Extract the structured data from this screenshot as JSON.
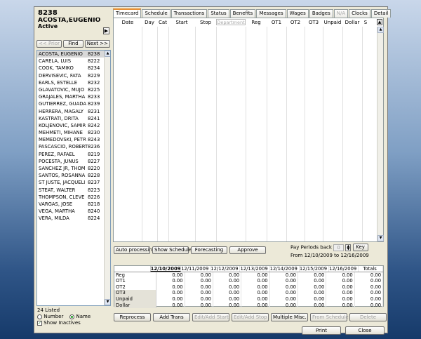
{
  "employee": {
    "id": "8238",
    "name": "ACOSTA,EUGENIO",
    "status": "Active"
  },
  "nav": {
    "prior": "<< Prior",
    "find": "Find",
    "next": "Next >>"
  },
  "employees": [
    {
      "name": "ACOSTA, EUGENIO",
      "id": "8238"
    },
    {
      "name": "CARELA, LUIS",
      "id": "8222"
    },
    {
      "name": "COOK, TAMIKO",
      "id": "8234"
    },
    {
      "name": "DERVISEVIC, FATA",
      "id": "8229"
    },
    {
      "name": "EARLS, ESTELLE",
      "id": "8232"
    },
    {
      "name": "GLAVATOVIC, MUJO",
      "id": "8225"
    },
    {
      "name": "GRAJALES, MARTHA",
      "id": "8233"
    },
    {
      "name": "GUTIERREZ, GUADA",
      "id": "8239"
    },
    {
      "name": "HERRERA, MAGALY",
      "id": "8231"
    },
    {
      "name": "KASTRATI, DRITA",
      "id": "8241"
    },
    {
      "name": "KOLJENOVIC, SAMIR",
      "id": "8242"
    },
    {
      "name": "MEHMETI, MIHANE",
      "id": "8230"
    },
    {
      "name": "MEMEDOVSKI, PETR",
      "id": "8243"
    },
    {
      "name": "PASCASCIO, ROBERT",
      "id": "8236"
    },
    {
      "name": "PEREZ, RAFAEL",
      "id": "8219"
    },
    {
      "name": "POCESTA, JUNUS",
      "id": "8227"
    },
    {
      "name": "SANCHEZ JR, THOM",
      "id": "8220"
    },
    {
      "name": "SANTOS, ROSANNA",
      "id": "8228"
    },
    {
      "name": "ST JUSTE, JACQUELI",
      "id": "8237"
    },
    {
      "name": "STEAT, WALTER",
      "id": "8223"
    },
    {
      "name": "THOMPSON, CLEVE",
      "id": "8226"
    },
    {
      "name": "VARGAS, JOSE",
      "id": "8218"
    },
    {
      "name": "VEGA, MARTHA",
      "id": "8240"
    },
    {
      "name": "VERA, MILDA",
      "id": "8224"
    }
  ],
  "list_footer": {
    "count": "24 Listed",
    "number": "Number",
    "name": "Name",
    "inactives": "Show Inactives"
  },
  "tabs": [
    "Timecard",
    "Schedule",
    "Transactions",
    "Status",
    "Benefits",
    "Messages",
    "Wages",
    "Badges",
    "N/A",
    "Clocks",
    "Detail"
  ],
  "timecard_columns": [
    "Date",
    "Day",
    "Cat",
    "Start",
    "Stop",
    "Department",
    "Reg",
    "OT1",
    "OT2",
    "OT3",
    "Unpaid",
    "Dollar",
    "S"
  ],
  "actions": {
    "auto": "Auto processing",
    "schedule": "Show Schedule",
    "forecast": "Forecasting",
    "approve": "Approve"
  },
  "pay_periods": {
    "label": "Pay Periods back",
    "value": "0",
    "key": "Key",
    "range": "From 12/10/2009 to 12/16/2009"
  },
  "summary": {
    "dates": [
      "12/10/2009",
      "12/11/2009",
      "12/12/2009",
      "12/13/2009",
      "12/14/2009",
      "12/15/2009",
      "12/16/2009",
      "Totals"
    ],
    "rows": [
      {
        "label": "Reg",
        "values": [
          "0.00",
          "0.00",
          "0.00",
          "0.00",
          "0.00",
          "0.00",
          "0.00",
          "0.00"
        ]
      },
      {
        "label": "OT1",
        "values": [
          "0.00",
          "0.00",
          "0.00",
          "0.00",
          "0.00",
          "0.00",
          "0.00",
          "0.00"
        ]
      },
      {
        "label": "OT2",
        "values": [
          "0.00",
          "0.00",
          "0.00",
          "0.00",
          "0.00",
          "0.00",
          "0.00",
          "0.00"
        ]
      },
      {
        "label": "OT3",
        "values": [
          "0.00",
          "0.00",
          "0.00",
          "0.00",
          "0.00",
          "0.00",
          "0.00",
          "0.00"
        ]
      },
      {
        "label": "Unpaid",
        "values": [
          "0.00",
          "0.00",
          "0.00",
          "0.00",
          "0.00",
          "0.00",
          "0.00",
          "0.00"
        ]
      },
      {
        "label": "Dollar",
        "values": [
          "0.00",
          "0.00",
          "0.00",
          "0.00",
          "0.00",
          "0.00",
          "0.00",
          "0.00"
        ]
      }
    ]
  },
  "bottom": {
    "reprocess": "Reprocess",
    "add_trans": "Add Trans",
    "edit_start": "Edit/Add Start",
    "edit_stop": "Edit/Add Stop",
    "multiple": "Multiple Misc.",
    "from_schedule": "From Schedule",
    "delete": "Delete"
  },
  "final": {
    "print": "Print",
    "close": "Close"
  }
}
